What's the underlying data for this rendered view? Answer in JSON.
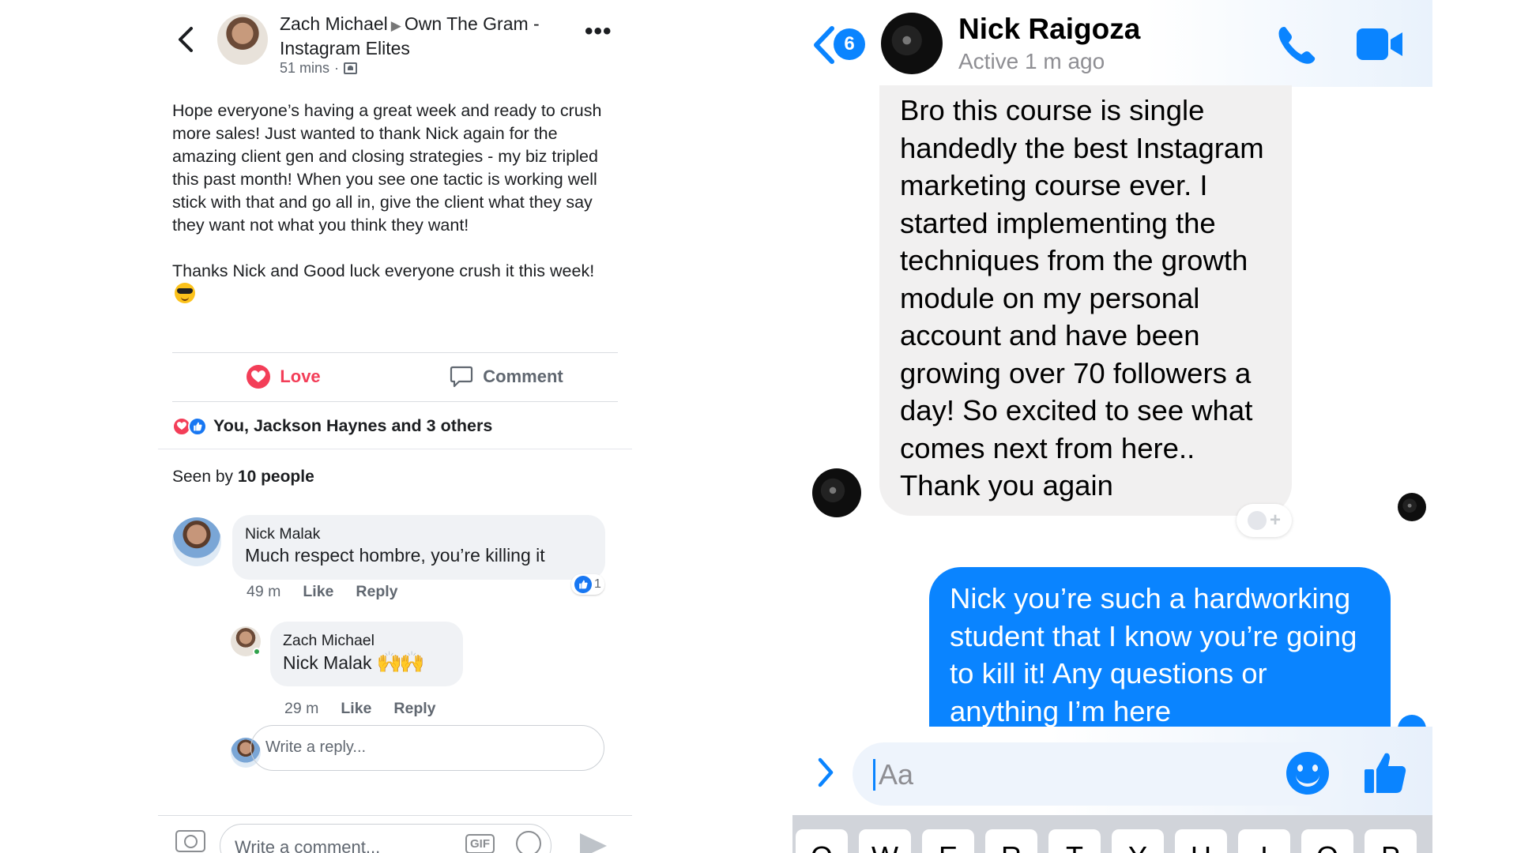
{
  "facebook_post": {
    "author": "Zach Michael",
    "group": "Own The Gram - Instagram Elites",
    "time": "51 mins",
    "meta_separator": "·",
    "body_paragraph_1": "Hope everyone’s having a great week and ready to crush more sales! Just wanted to thank Nick again for the amazing client gen and closing strategies - my biz tripled this past month! When you see one tactic is working well stick with that and go all in, give the client what they say they want not what you think they want!",
    "body_paragraph_2": "Thanks Nick and Good luck everyone crush it this week!",
    "actions": {
      "love": "Love",
      "comment": "Comment"
    },
    "reactions_summary": "You, Jackson Haynes and 3 others",
    "seen_by_prefix": "Seen by",
    "seen_by_count": "10 people",
    "comments": [
      {
        "name": "Nick Malak",
        "text": "Much respect hombre, you’re killing it",
        "time": "49 m",
        "like_label": "Like",
        "reply_label": "Reply",
        "like_count": "1"
      },
      {
        "name": "Zach Michael",
        "text": "Nick Malak",
        "emoji": "🙌🙌",
        "time": "29 m",
        "like_label": "Like",
        "reply_label": "Reply"
      }
    ],
    "reply_placeholder": "Write a reply...",
    "comment_placeholder": "Write a comment...",
    "gif_label": "GIF"
  },
  "messenger": {
    "back_badge_count": "6",
    "contact_name": "Nick Raigoza",
    "contact_status": "Active 1 m ago",
    "incoming_message": "Bro this course is single handedly the best Instagram marketing course ever. I started implementing the techniques from the growth module on my personal account and have been growing over 70 followers a day! So excited to see what comes next from here.. Thank you again",
    "outgoing_message": "Nick you’re such a hardworking student that I know you’re going to kill it! Any questions or anything I’m here",
    "compose_placeholder": "Aa",
    "keyboard_keys": [
      "Q",
      "W",
      "E",
      "R",
      "T",
      "Y",
      "U",
      "I",
      "O",
      "P"
    ],
    "colors": {
      "accent": "#0a84ff",
      "love": "#f33e58",
      "fb_blue": "#1877f2"
    }
  }
}
